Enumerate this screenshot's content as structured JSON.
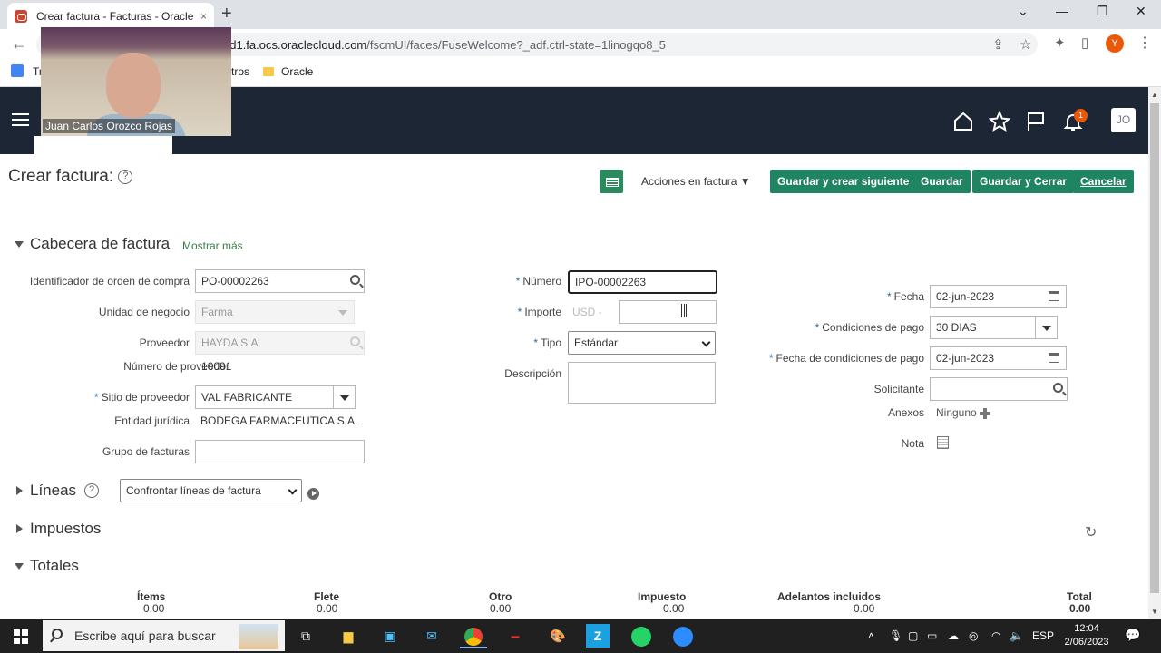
{
  "browser": {
    "tab_title": "Crear factura - Facturas - Oracle",
    "tab_close": "×",
    "new_tab": "+",
    "url_prefix": "od1.fa.ocs.oraclecloud.com",
    "url_rest": "/fscmUI/faces/FuseWelcome?_adf.ctrl-state=1linogqo8_5",
    "bookmarks": [
      "Tr",
      "tros",
      "Oracle"
    ],
    "profile_initial": "Y"
  },
  "webcam": {
    "name": "Juan Carlos Orozco Rojas"
  },
  "header": {
    "notif_count": "1",
    "user_initials": "JO"
  },
  "page": {
    "title": "Crear factura:",
    "help_glyph": "?",
    "actions_menu": "Acciones en factura",
    "buttons": {
      "save_next": "Guardar y crear siguiente",
      "save": "Guardar",
      "save_close": "Guardar y Cerrar",
      "cancel": "Cancelar"
    }
  },
  "header_section": {
    "title": "Cabecera de factura",
    "show_more": "Mostrar más",
    "fields": {
      "po_label": "Identificador de orden de compra",
      "po_value": "PO-00002263",
      "bu_label": "Unidad de negocio",
      "bu_value": "Farma",
      "supplier_label": "Proveedor",
      "supplier_value": "HAYDA S.A.",
      "supplier_num_label": "Número de proveedor",
      "supplier_num_value": "10091",
      "site_label": "Sitio de proveedor",
      "site_value": "VAL FABRICANTE",
      "legal_label": "Entidad jurídica",
      "legal_value": "BODEGA FARMACEUTICA S.A.",
      "group_label": "Grupo de facturas",
      "group_value": "",
      "number_label": "Número",
      "number_value": "IPO-00002263",
      "amount_label": "Importe",
      "currency_value": "USD -",
      "amount_value": "",
      "type_label": "Tipo",
      "type_value": "Estándar",
      "desc_label": "Descripción",
      "desc_value": "",
      "date_label": "Fecha",
      "date_value": "02-jun-2023",
      "terms_label": "Condiciones de pago",
      "terms_value": "30 DIAS",
      "terms_date_label": "Fecha de condiciones de pago",
      "terms_date_value": "02-jun-2023",
      "requester_label": "Solicitante",
      "requester_value": "",
      "attach_label": "Anexos",
      "attach_value": "Ninguno",
      "note_label": "Nota"
    }
  },
  "lines_section": {
    "title": "Líneas",
    "match_select": "Confrontar líneas de factura"
  },
  "taxes_section": {
    "title": "Impuestos"
  },
  "totals_section": {
    "title": "Totales",
    "columns": [
      {
        "label": "Ítems",
        "value": "0.00"
      },
      {
        "label": "Flete",
        "value": "0.00"
      },
      {
        "label": "Otro",
        "value": "0.00"
      },
      {
        "label": "Impuesto",
        "value": "0.00"
      },
      {
        "label": "Adelantos incluidos",
        "value": "0.00"
      },
      {
        "label": "Total",
        "value": "0.00"
      }
    ]
  },
  "taskbar": {
    "search_text": "Escribe aquí para buscar",
    "lang": "ESP",
    "time": "12:04",
    "date": "2/06/2023"
  }
}
